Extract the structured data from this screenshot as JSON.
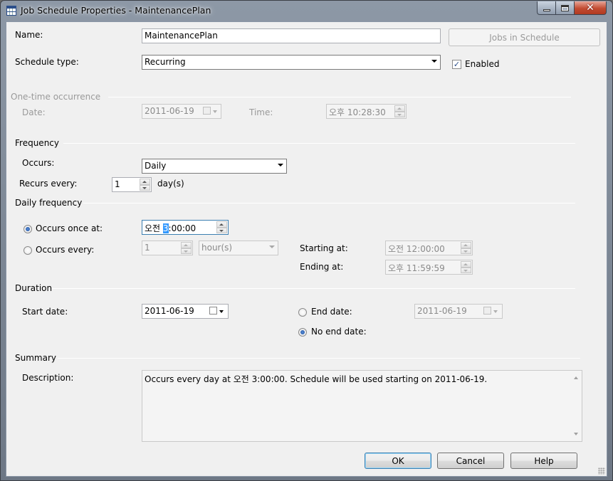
{
  "window": {
    "title": "Job Schedule Properties - MaintenancePlan"
  },
  "name": {
    "label": "Name:",
    "value": "MaintenancePlan"
  },
  "jobs_button": "Jobs in Schedule",
  "schedule_type": {
    "label": "Schedule type:",
    "value": "Recurring"
  },
  "enabled": {
    "label": "Enabled",
    "checked": true,
    "glyph": "✓"
  },
  "one_time": {
    "group_label": "One-time occurrence",
    "date_label": "Date:",
    "date_value": "2011-06-19",
    "time_label": "Time:",
    "time_value": "오후 10:28:30"
  },
  "frequency": {
    "group_label": "Frequency",
    "occurs_label": "Occurs:",
    "occurs_value": "Daily",
    "recurs_label": "Recurs every:",
    "recurs_value": "1",
    "recurs_unit": "day(s)"
  },
  "daily_frequency": {
    "group_label": "Daily frequency",
    "once_label": "Occurs once at:",
    "once_prefix": "오전 ",
    "once_selected": "3",
    "once_suffix": ":00:00",
    "every_label": "Occurs every:",
    "every_value": "1",
    "every_unit": "hour(s)",
    "starting_label": "Starting at:",
    "starting_value": "오전 12:00:00",
    "ending_label": "Ending at:",
    "ending_value": "오후 11:59:59"
  },
  "duration": {
    "group_label": "Duration",
    "start_label": "Start date:",
    "start_value": "2011-06-19",
    "end_label": "End date:",
    "end_value": "2011-06-19",
    "no_end_label": "No end date:"
  },
  "summary": {
    "group_label": "Summary",
    "description_label": "Description:",
    "description_text": "Occurs every day at 오전 3:00:00. Schedule will be used starting on 2011-06-19."
  },
  "buttons": {
    "ok": "OK",
    "cancel": "Cancel",
    "help": "Help"
  },
  "icons": {
    "close": "✕",
    "app": "table-icon"
  }
}
